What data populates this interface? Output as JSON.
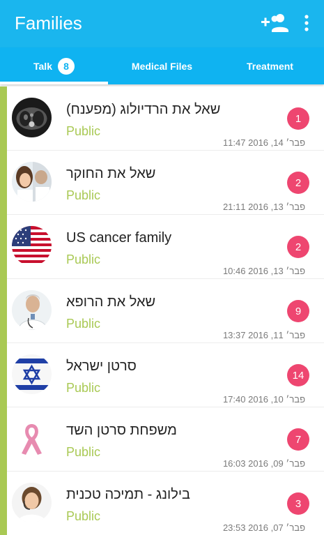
{
  "appbar": {
    "title": "Families",
    "add_icon": "add-group-icon",
    "more_icon": "more-vert-icon"
  },
  "tabs": [
    {
      "label": "Talk",
      "badge": "8",
      "selected": true
    },
    {
      "label": "Medical Files"
    },
    {
      "label": "Treatment"
    }
  ],
  "colors": {
    "appbar": "#1ab6ee",
    "tabbar": "#0fb3f1",
    "accent_green": "#a9c954",
    "badge_pink": "#ee4670"
  },
  "groups": [
    {
      "name": "שאל את הרדיולוג (מפענח)",
      "visibility": "Public",
      "count": "1",
      "time": "פבר׳ 14, 2016 11:47",
      "avatar": "radiology-scan"
    },
    {
      "name": "שאל את החוקר",
      "visibility": "Public",
      "count": "2",
      "time": "פבר׳ 13, 2016 21:11",
      "avatar": "researcher-photo"
    },
    {
      "name": "US cancer family",
      "visibility": "Public",
      "count": "2",
      "time": "פבר׳ 13, 2016 10:46",
      "avatar": "us-flag"
    },
    {
      "name": "שאל את הרופא",
      "visibility": "Public",
      "count": "9",
      "time": "פבר׳ 11, 2016 13:37",
      "avatar": "doctor-photo"
    },
    {
      "name": "סרטן ישראל",
      "visibility": "Public",
      "count": "14",
      "time": "פבר׳ 10, 2016 17:40",
      "avatar": "israel-flag"
    },
    {
      "name": "משפחת סרטן השד",
      "visibility": "Public",
      "count": "7",
      "time": "פבר׳ 09, 2016 16:03",
      "avatar": "pink-ribbon"
    },
    {
      "name": "בילונג - תמיכה טכנית",
      "visibility": "Public",
      "count": "3",
      "time": "פבר׳ 07, 2016 23:53",
      "avatar": "support-agent-photo"
    }
  ]
}
